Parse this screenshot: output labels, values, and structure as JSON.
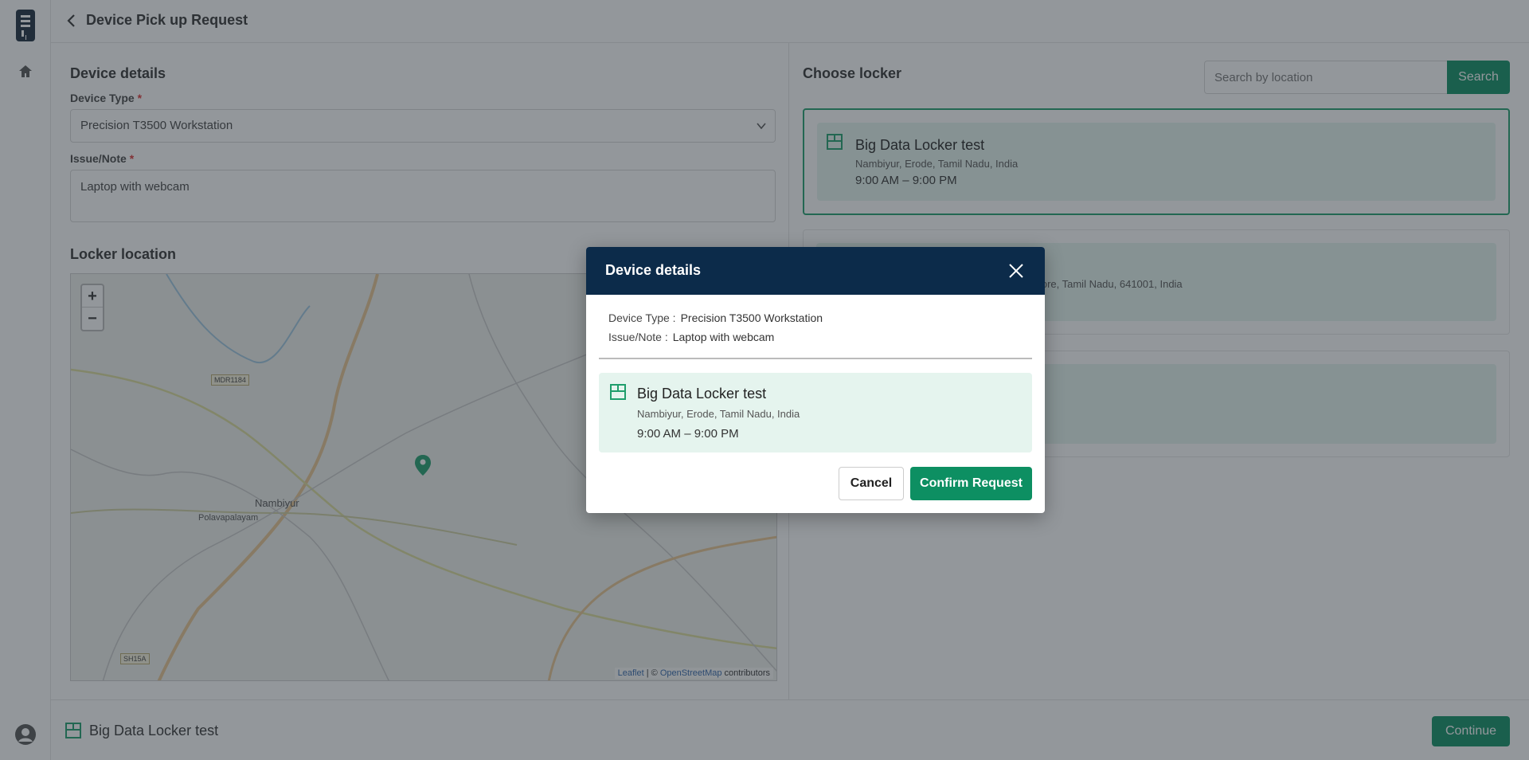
{
  "header": {
    "title": "Device Pick up Request"
  },
  "device_form": {
    "section_title": "Device details",
    "device_type_label": "Device Type",
    "device_type_value": "Precision T3500 Workstation",
    "issue_label": "Issue/Note",
    "issue_value": "Laptop with webcam",
    "required_mark": "*"
  },
  "map": {
    "section_title": "Locker location",
    "zoom_in": "+",
    "zoom_out": "−",
    "labels": [
      "Nambiyur",
      "Polavapalayam"
    ],
    "badges": [
      "MDR1184",
      "SH15A"
    ],
    "attribution_leaflet": "Leaflet",
    "attribution_sep": " | © ",
    "attribution_osm": "OpenStreetMap",
    "attribution_suffix": " contributors"
  },
  "locker_list": {
    "title": "Choose locker",
    "search_placeholder": "Search by location",
    "search_button": "Search",
    "lockers": [
      {
        "name": "Big Data Locker test",
        "address": "Nambiyur, Erode, Tamil Nadu, India",
        "hours": "9:00 AM – 9:00 PM"
      },
      {
        "address_fragment": "atore, Tamil Nadu, 641001, India"
      }
    ]
  },
  "footer": {
    "selected_locker": "Big Data Locker test",
    "continue_button": "Continue"
  },
  "modal": {
    "title": "Device details",
    "device_type_label": "Device Type :",
    "device_type_value": "Precision T3500 Workstation",
    "issue_label": "Issue/Note :",
    "issue_value": "Laptop with webcam",
    "locker_name": "Big Data Locker test",
    "locker_address": "Nambiyur, Erode, Tamil Nadu, India",
    "locker_hours": "9:00 AM – 9:00 PM",
    "cancel_button": "Cancel",
    "confirm_button": "Confirm Request"
  },
  "colors": {
    "accent": "#0d8f62",
    "modal_header": "#0c2b4a",
    "card_bg": "#e5f4ee"
  }
}
